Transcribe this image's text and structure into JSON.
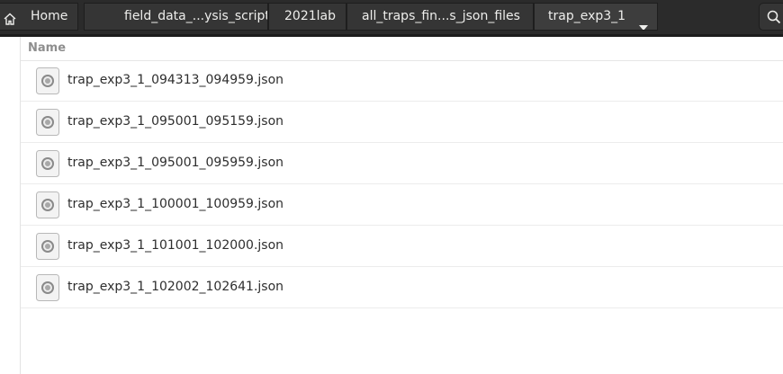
{
  "breadcrumbs": {
    "home_label": "Home",
    "items": [
      {
        "label": "field_data_...ysis_scripts"
      },
      {
        "label": "2021lab"
      },
      {
        "label": "all_traps_fin...s_json_files"
      },
      {
        "label": "trap_exp3_1"
      }
    ]
  },
  "icons": {
    "home": "home-icon",
    "dropdown": "chevron-down-icon",
    "search": "search-icon",
    "file": "json-file-icon"
  },
  "list": {
    "column_name": "Name",
    "files": [
      {
        "name": "trap_exp3_1_094313_094959.json"
      },
      {
        "name": "trap_exp3_1_095001_095159.json"
      },
      {
        "name": "trap_exp3_1_095001_095959.json"
      },
      {
        "name": "trap_exp3_1_100001_100959.json"
      },
      {
        "name": "trap_exp3_1_101001_102000.json"
      },
      {
        "name": "trap_exp3_1_102002_102641.json"
      }
    ]
  },
  "colors": {
    "toolbar_bg": "#2b2b2b",
    "crumb_bg": "#353535",
    "crumb_text": "#eeeeec",
    "list_bg": "#ffffff",
    "header_text": "#8e8e8e",
    "row_text": "#2e2e2e"
  }
}
